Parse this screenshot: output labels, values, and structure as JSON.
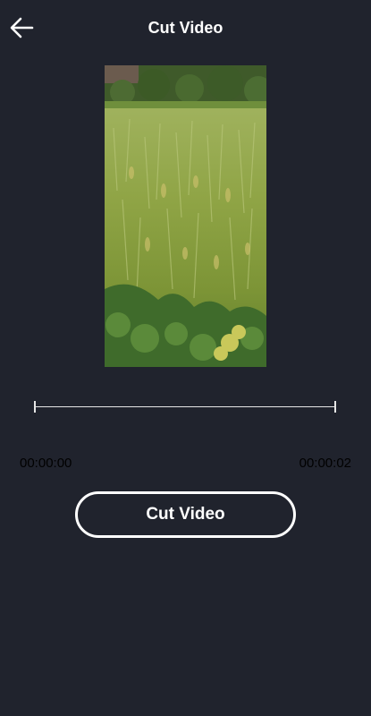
{
  "header": {
    "title": "Cut Video",
    "back_icon": "arrow-left-icon"
  },
  "video": {
    "thumbnail": "rice-paddy-field"
  },
  "trim": {
    "start_time": "00:00:00",
    "end_time": "00:00:02"
  },
  "actions": {
    "cut_label": "Cut Video"
  },
  "colors": {
    "background": "#20232d",
    "text": "#ffffff",
    "time_text": "#000000"
  }
}
